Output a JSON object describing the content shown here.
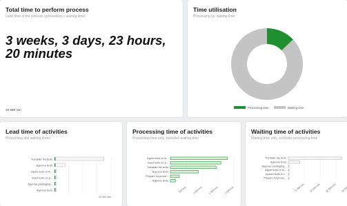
{
  "cards": {
    "total": {
      "title": "Total time to perform process",
      "subtitle": "Lead time of the process (processing + waiting time)",
      "value": "3 weeks, 3 days, 23 hours, 20 minutes",
      "footnote": "33 980 min"
    },
    "utilisation": {
      "title": "Time utilisation",
      "subtitle": "Processing vs. waiting time",
      "legend_processing": "Processing time",
      "legend_waiting": "Waiting time"
    },
    "lead": {
      "title": "Lead time of activities",
      "subtitle": "Processing and waiting times",
      "axis_tick": "20 000 min"
    },
    "processing": {
      "title": "Processing time of activities",
      "subtitle": "Processing time only, excludes waiting time",
      "axis_ticks": [
        "500 min",
        "1 000 min",
        "1 500 min",
        "2 000 min"
      ]
    },
    "waiting": {
      "title": "Waiting time of activities",
      "subtitle": "Waiting time only, excludes processing time",
      "axis_ticks": [
        "5 000 min",
        "10 000 min",
        "15 000 min",
        "20 000 min"
      ]
    }
  },
  "colors": {
    "processing": "#1f8f2f",
    "waiting": "#c4c4c4",
    "background": "#eceeef"
  },
  "chart_data": [
    {
      "type": "pie",
      "categories": [
        "Processing time",
        "Waiting time"
      ],
      "values": [
        0.13,
        0.87
      ]
    },
    {
      "type": "bar",
      "orientation": "horizontal",
      "categories": [
        "Translate the texts",
        "Approve texts",
        "Agree texts of th...",
        "Insert texts on p...",
        "Approve packaging...",
        "Approve texts"
      ],
      "series": [
        {
          "name": "Processing time",
          "values": [
            150,
            60,
            120,
            130,
            120,
            80
          ]
        },
        {
          "name": "Waiting time",
          "values": [
            21500,
            4500,
            500,
            700,
            500,
            500
          ]
        }
      ],
      "xlim": [
        0,
        25000
      ]
    },
    {
      "type": "bar",
      "orientation": "horizontal",
      "categories": [
        "Agree texts of th...",
        "Insert texts on p...",
        "Translate the texts",
        "Approve texts",
        "Prepare for produ...",
        "Approve texts"
      ],
      "values": [
        2250,
        1990,
        1800,
        1100,
        350,
        200
      ],
      "xlim": [
        0,
        2500
      ]
    },
    {
      "type": "bar",
      "orientation": "horizontal",
      "categories": [
        "Translate the texts",
        "Approve texts",
        "Approve packaging...",
        "Agree texts of th...",
        "Upload texts in t...",
        "Prepare for produ..."
      ],
      "values": [
        21000,
        4500,
        200,
        150,
        100,
        60
      ],
      "xlim": [
        0,
        25000
      ]
    }
  ]
}
